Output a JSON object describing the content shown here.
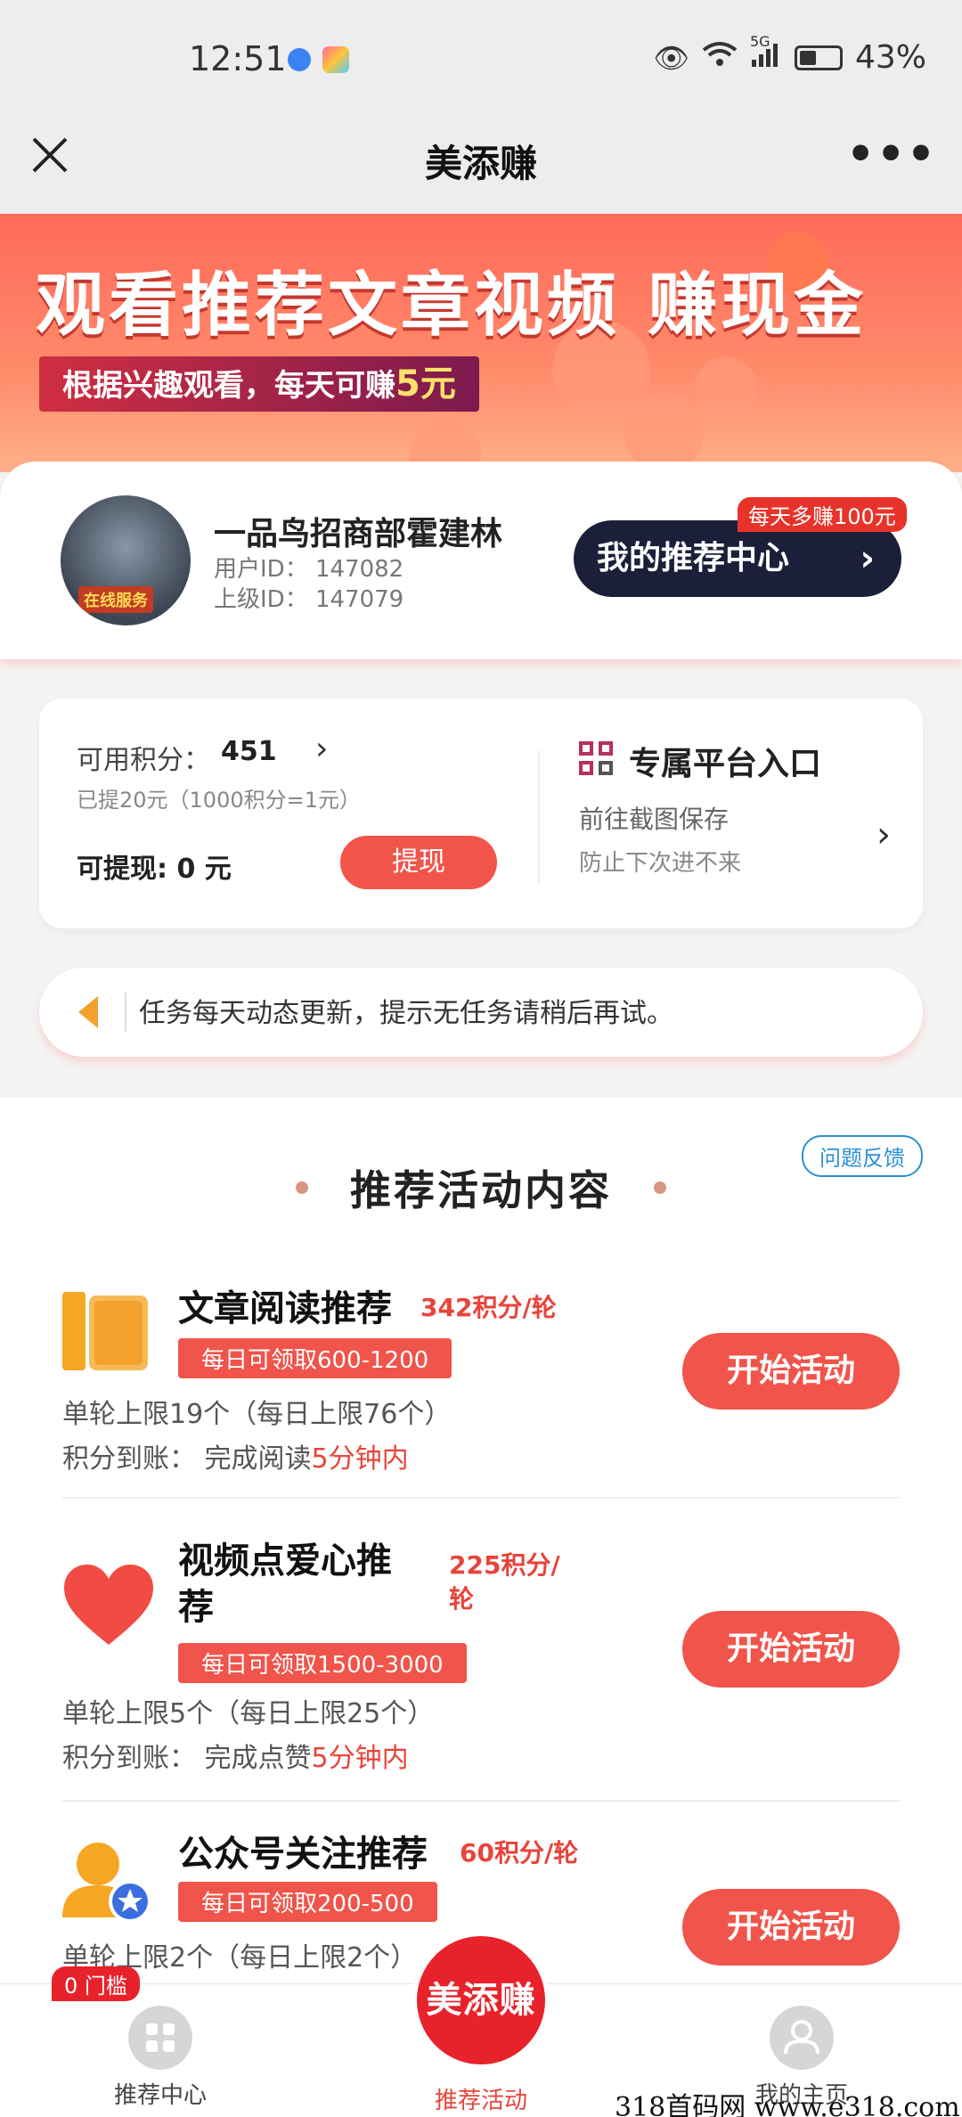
{
  "status_bar": {
    "time": "12:51",
    "network": "5G",
    "battery": "43%"
  },
  "header": {
    "title": "美添赚"
  },
  "banner": {
    "title": "观看推荐文章视频 赚现金",
    "subtitle_prefix": "根据兴趣观看，每天可赚",
    "subtitle_amount": "5元"
  },
  "profile": {
    "avatar_tag": "在线服务",
    "name": "一品鸟招商部霍建林",
    "user_id": "用户ID：  147082",
    "parent_id": "上级ID：  147079",
    "badge": "每天多赚100元",
    "rec_center_label": "我的推荐中心"
  },
  "points": {
    "label": "可用积分：",
    "value": "451",
    "note": "已提20元（1000积分=1元）",
    "withdrawable": "可提现: 0 元",
    "withdraw_button": "提现",
    "platform_title": "专属平台入口",
    "platform_sub1": "前往截图保存",
    "platform_sub2": "防止下次进不来"
  },
  "notice": {
    "text": "任务每天动态更新，提示无任务请稍后再试。"
  },
  "section": {
    "feedback": "问题反馈",
    "title": "推荐活动内容",
    "activities": [
      {
        "title": "文章阅读推荐",
        "points": "342积分/轮",
        "tag": "每日可领取600-1200",
        "limit": "单轮上限19个（每日上限76个）",
        "time_prefix": "积分到账：  完成阅读",
        "time_value": "5分钟内",
        "button": "开始活动"
      },
      {
        "title_line1": "视频点爱心推",
        "title_line2": "荐",
        "points_line1": "225积分/",
        "points_line2": "轮",
        "tag": "每日可领取1500-3000",
        "limit": "单轮上限5个（每日上限25个）",
        "time_prefix": "积分到账：  完成点赞",
        "time_value": "5分钟内",
        "button": "开始活动"
      },
      {
        "title": "公众号关注推荐",
        "points": "60积分/轮",
        "tag": "每日可领取200-500",
        "limit": "单轮上限2个（每日上限2个）",
        "button": "开始活动"
      }
    ]
  },
  "bottom_nav": {
    "threshold_badge": "0 门槛",
    "items": [
      "推荐中心",
      "推荐活动",
      "我的主页"
    ],
    "center_logo": "美添赚"
  },
  "watermark": "318首码网 www.e318.com",
  "colors": {
    "accent": "#f0544a",
    "dark_button": "#1c1f3a",
    "points_red": "#e8443a"
  }
}
